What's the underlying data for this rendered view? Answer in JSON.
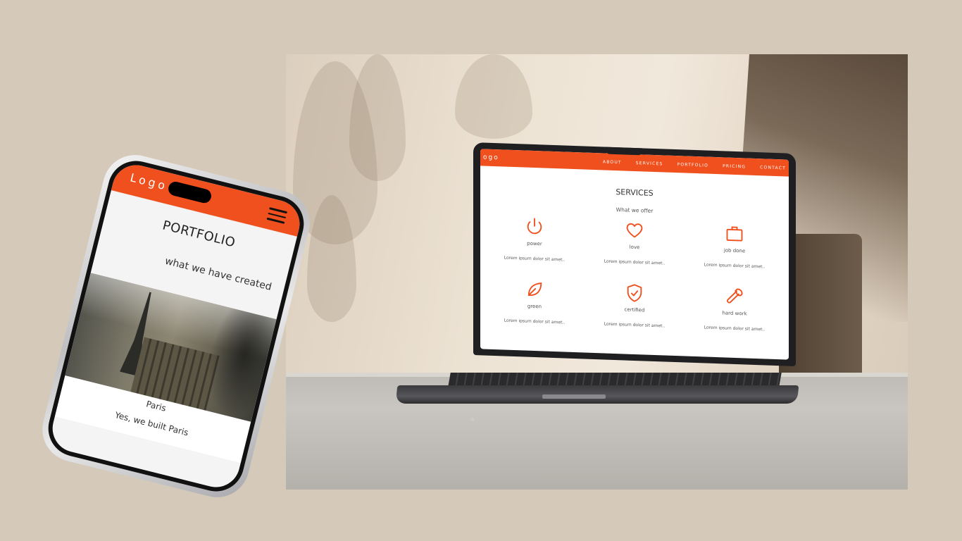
{
  "laptop": {
    "logo": "ogo",
    "nav": [
      "ABOUT",
      "SERVICES",
      "PORTFOLIO",
      "PRICING",
      "CONTACT"
    ],
    "section_title": "SERVICES",
    "section_subtitle": "What we offer",
    "services": [
      {
        "name": "power",
        "icon": "power-icon",
        "text": "Lorem ipsum dolor sit amet.."
      },
      {
        "name": "love",
        "icon": "heart-icon",
        "text": "Lorem ipsum dolor sit amet.."
      },
      {
        "name": "job done",
        "icon": "briefcase-icon",
        "text": "Lorem ipsum dolor sit amet.."
      },
      {
        "name": "green",
        "icon": "leaf-icon",
        "text": "Lorem ipsum dolor sit amet.."
      },
      {
        "name": "certified",
        "icon": "shield-check-icon",
        "text": "Lorem ipsum dolor sit amet.."
      },
      {
        "name": "hard work",
        "icon": "wrench-icon",
        "text": "Lorem ipsum dolor sit amet.."
      }
    ]
  },
  "phone": {
    "logo": "Logo",
    "title": "PORTFOLIO",
    "subtitle": "what we have created",
    "photo_caption": "Paris",
    "photo_description": "Yes, we built Paris"
  },
  "colors": {
    "accent": "#f0501e",
    "background": "#d5c9b9"
  }
}
